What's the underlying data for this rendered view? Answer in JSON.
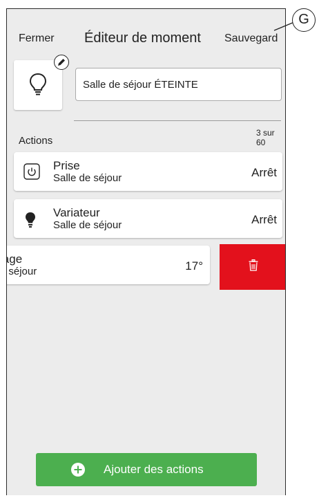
{
  "header": {
    "close_label": "Fermer",
    "title": "Éditeur de moment",
    "save_label": "Sauvegard"
  },
  "moment": {
    "icon": "lightbulb-outline-icon",
    "name": "Salle de séjour ÉTEINTE"
  },
  "actions": {
    "label": "Actions",
    "count": "3 sur 60",
    "items": [
      {
        "icon": "power-icon",
        "name": "Prise",
        "room": "Salle de séjour",
        "value": "Arrêt"
      },
      {
        "icon": "lightbulb-filled-icon",
        "name": "Variateur",
        "room": "Salle de séjour",
        "value": "Arrêt"
      },
      {
        "name": "Chauffage",
        "room": "Salle de séjour",
        "value": "17°"
      }
    ]
  },
  "delete": {
    "icon": "trash-icon",
    "color": "#e3111c"
  },
  "add_button": {
    "label": "Ajouter des actions",
    "icon": "plus-circle-icon",
    "color": "#4caf4f"
  },
  "callout": {
    "label": "G"
  }
}
